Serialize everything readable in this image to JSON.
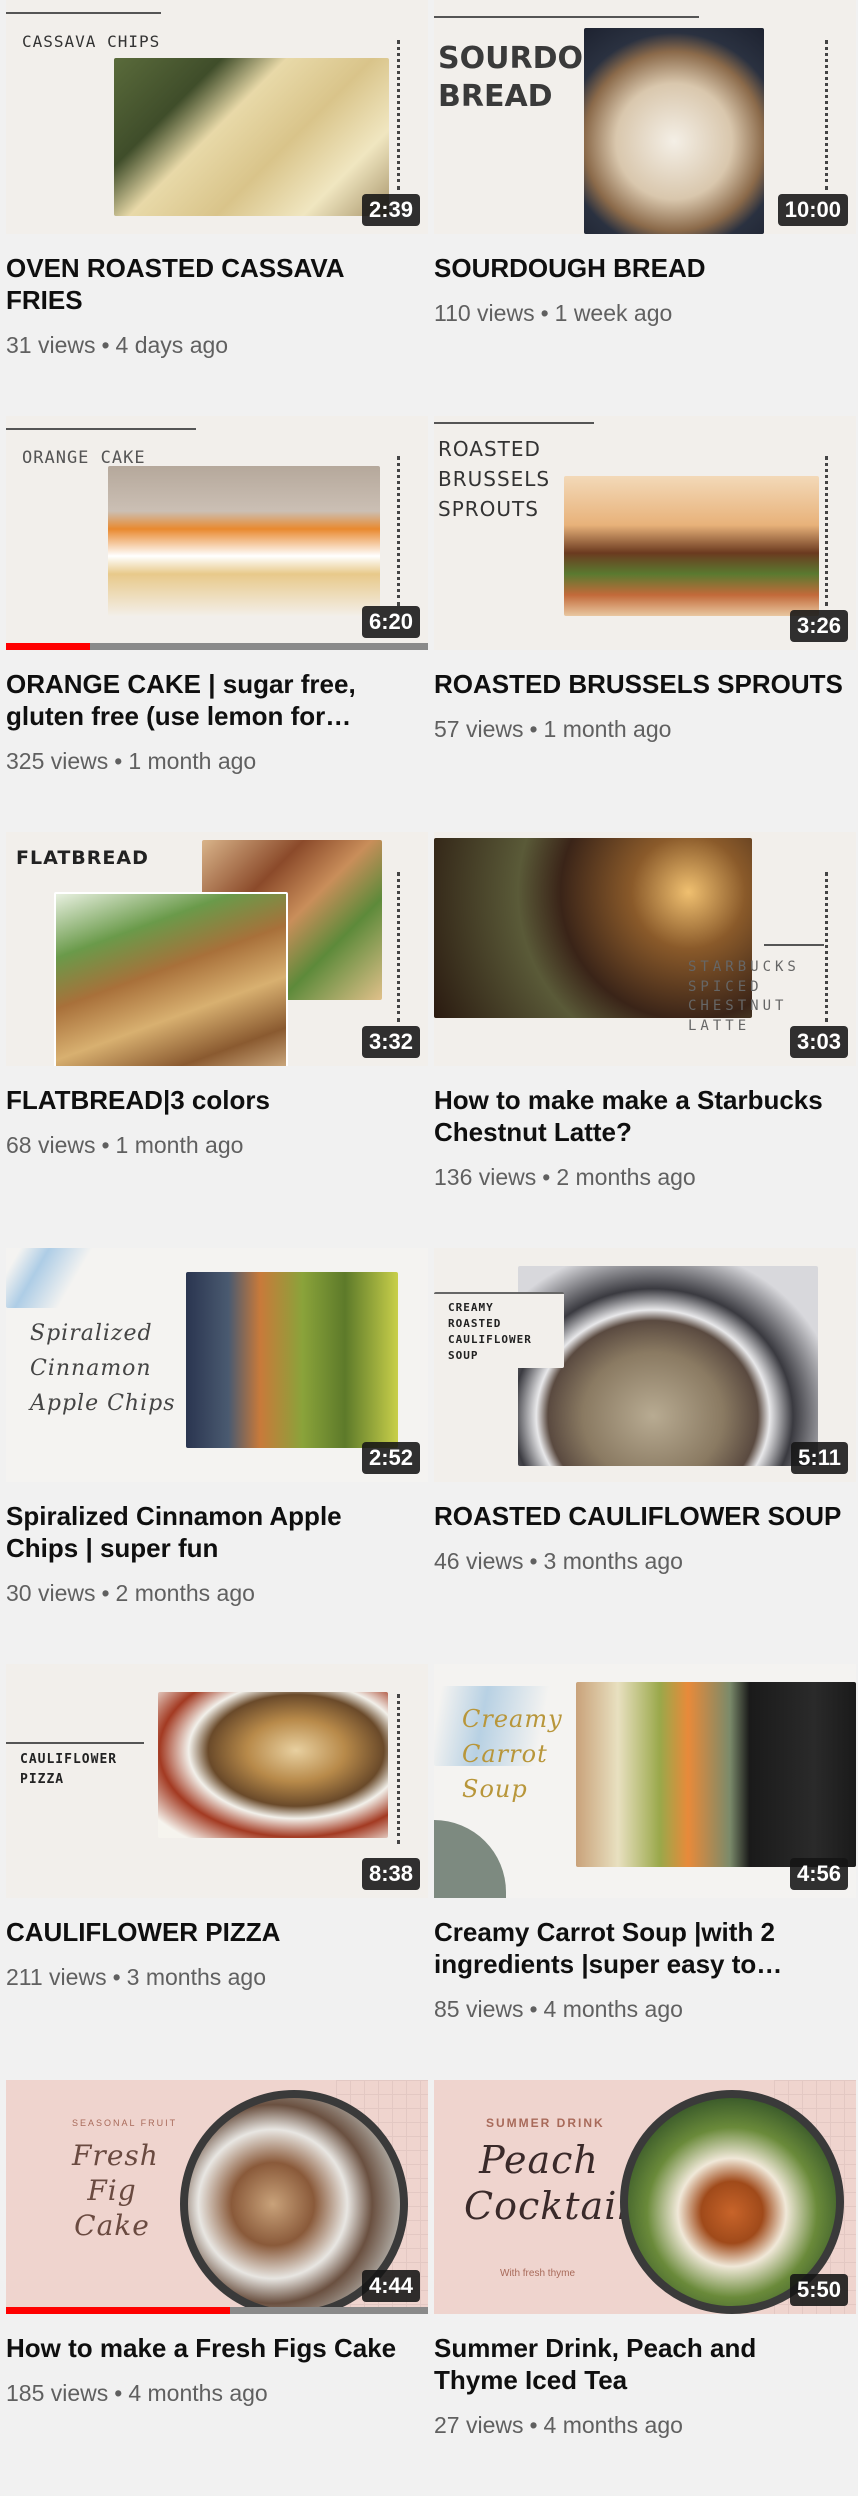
{
  "videos": [
    {
      "thumb_text": "CASSAVA CHIPS",
      "duration": "2:39",
      "title": "OVEN ROASTED CASSAVA FRIES",
      "views": "31 views",
      "age": "4 days ago",
      "progress": 0
    },
    {
      "thumb_text": "SOURDOUG\nBREAD",
      "duration": "10:00",
      "title": "SOURDOUGH BREAD",
      "views": "110 views",
      "age": "1 week ago",
      "progress": 0
    },
    {
      "thumb_text": "ORANGE CAKE",
      "duration": "6:20",
      "title": "ORANGE CAKE | sugar free, gluten free (use lemon for…",
      "views": "325 views",
      "age": "1 month ago",
      "progress": 0.2
    },
    {
      "thumb_text": "ROASTED\nBRUSSELS\nSPROUTS",
      "duration": "3:26",
      "title": "ROASTED BRUSSELS SPROUTS",
      "views": "57 views",
      "age": "1 month ago",
      "progress": 0
    },
    {
      "thumb_text": "FLATBREAD",
      "duration": "3:32",
      "title": "FLATBREAD|3 colors",
      "views": "68 views",
      "age": "1 month ago",
      "progress": 0
    },
    {
      "thumb_text": "STARBUCKS\nSPICED\nCHESTNUT\nLATTE",
      "duration": "3:03",
      "title": "How to make make a Starbucks Chestnut Latte?",
      "views": "136 views",
      "age": "2 months ago",
      "progress": 0
    },
    {
      "thumb_text": "Spiralized\nCinnamon\nApple Chips",
      "duration": "2:52",
      "title": "Spiralized Cinnamon Apple Chips | super fun",
      "views": "30 views",
      "age": "2 months ago",
      "progress": 0
    },
    {
      "thumb_text": "CREAMY\nROASTED\nCAULIFLOWER\nSOUP",
      "duration": "5:11",
      "title": "ROASTED CAULIFLOWER SOUP",
      "views": "46 views",
      "age": "3 months ago",
      "progress": 0
    },
    {
      "thumb_text": "CAULIFLOWER\nPIZZA",
      "duration": "8:38",
      "title": "CAULIFLOWER PIZZA",
      "views": "211 views",
      "age": "3 months ago",
      "progress": 0
    },
    {
      "thumb_text": "Creamy\nCarrot\nSoup",
      "duration": "4:56",
      "title": "Creamy Carrot Soup |with 2 ingredients |super easy to…",
      "views": "85 views",
      "age": "4 months ago",
      "progress": 0
    },
    {
      "thumb_text": "Fresh\nFig\nCake",
      "thumb_small": "SEASONAL FRUIT",
      "duration": "4:44",
      "title": "How to make a Fresh Figs Cake",
      "views": "185 views",
      "age": "4 months ago",
      "progress": 0.53
    },
    {
      "thumb_text": "Peach\nCocktail",
      "thumb_small": "SUMMER DRINK",
      "thumb_sub": "With fresh thyme",
      "duration": "5:50",
      "title": "Summer Drink, Peach and Thyme Iced Tea",
      "views": "27 views",
      "age": "4 months ago",
      "progress": 0
    }
  ],
  "separator": "•"
}
